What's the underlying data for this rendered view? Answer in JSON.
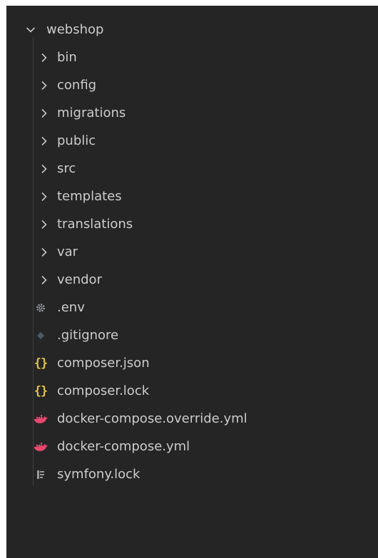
{
  "explorer": {
    "root": {
      "label": "webshop",
      "icon": "chevron-down-icon",
      "expanded": true
    },
    "folders": [
      {
        "label": "bin",
        "icon": "chevron-right-icon"
      },
      {
        "label": "config",
        "icon": "chevron-right-icon"
      },
      {
        "label": "migrations",
        "icon": "chevron-right-icon"
      },
      {
        "label": "public",
        "icon": "chevron-right-icon"
      },
      {
        "label": "src",
        "icon": "chevron-right-icon"
      },
      {
        "label": "templates",
        "icon": "chevron-right-icon"
      },
      {
        "label": "translations",
        "icon": "chevron-right-icon"
      },
      {
        "label": "var",
        "icon": "chevron-right-icon"
      },
      {
        "label": "vendor",
        "icon": "chevron-right-icon"
      }
    ],
    "files": [
      {
        "label": ".env",
        "icon": "gear-icon",
        "icon_color": "#8a8f98"
      },
      {
        "label": ".gitignore",
        "icon": "git-dot-icon",
        "icon_color": "#4b5a66"
      },
      {
        "label": "composer.json",
        "icon": "json-braces-icon",
        "icon_color": "#e2c044"
      },
      {
        "label": "composer.lock",
        "icon": "json-braces-icon",
        "icon_color": "#e2c044"
      },
      {
        "label": "docker-compose.override.yml",
        "icon": "docker-whale-icon",
        "icon_color": "#e8486f"
      },
      {
        "label": "docker-compose.yml",
        "icon": "docker-whale-icon",
        "icon_color": "#e8486f"
      },
      {
        "label": "symfony.lock",
        "icon": "document-lines-icon",
        "icon_color": "#9a9a9a"
      }
    ]
  },
  "colors": {
    "panel_background": "#252526",
    "text": "#cccccc"
  }
}
